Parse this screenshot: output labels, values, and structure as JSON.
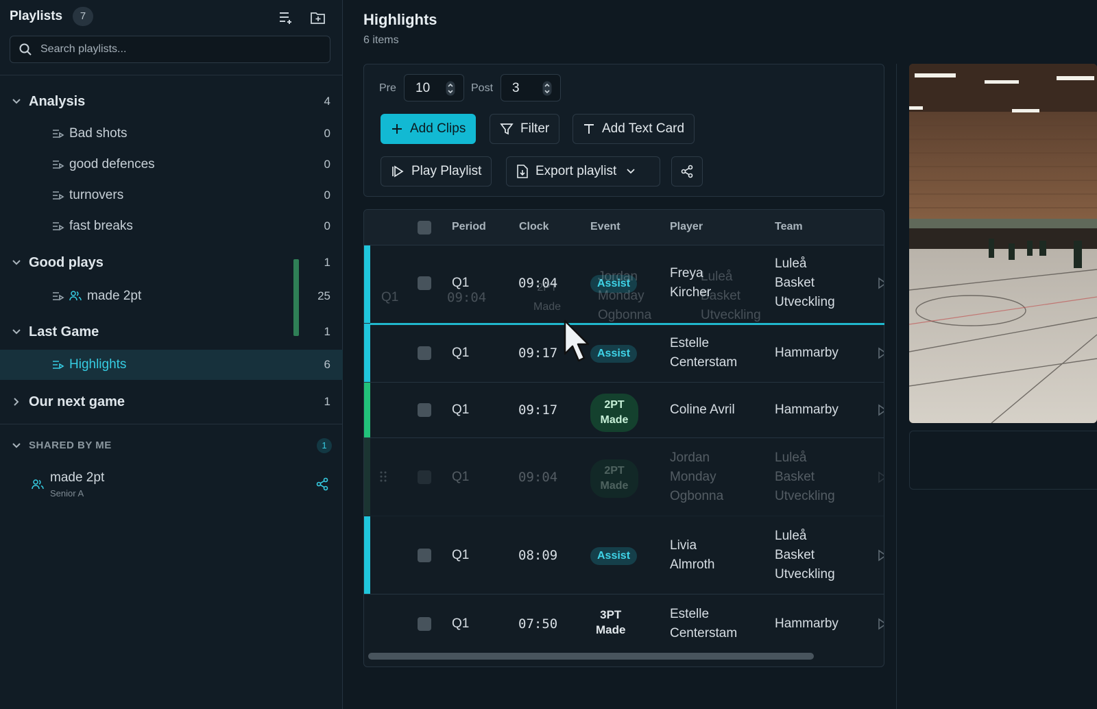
{
  "sidebar": {
    "title": "Playlists",
    "count": "7",
    "search_placeholder": "Search playlists...",
    "groups": [
      {
        "label": "Analysis",
        "count": "4"
      },
      {
        "label": "Good plays",
        "count": "1"
      },
      {
        "label": "Last Game",
        "count": "1"
      },
      {
        "label": "Our next game",
        "count": "1"
      }
    ],
    "items": [
      {
        "label": "Bad shots",
        "count": "0"
      },
      {
        "label": "good defences",
        "count": "0"
      },
      {
        "label": "turnovers",
        "count": "0"
      },
      {
        "label": "fast breaks",
        "count": "0"
      },
      {
        "label": "made 2pt",
        "count": "25"
      },
      {
        "label": "Highlights",
        "count": "6"
      }
    ],
    "shared": {
      "header": "SHARED BY ME",
      "count": "1",
      "item_label": "made 2pt",
      "item_sub": "Senior A"
    }
  },
  "main": {
    "title": "Highlights",
    "subtitle": "6 items",
    "pre_label": "Pre",
    "pre_value": "10",
    "post_label": "Post",
    "post_value": "3",
    "buttons": {
      "add_clips": "Add Clips",
      "filter": "Filter",
      "add_text_card": "Add Text Card",
      "play_playlist": "Play Playlist",
      "export_playlist": "Export playlist"
    },
    "table": {
      "headers": [
        "Period",
        "Clock",
        "Event",
        "Player",
        "Team"
      ],
      "rows": [
        {
          "period": "Q1",
          "clock": "09:04",
          "event": "Assist",
          "player1": "Freya",
          "player2": "Kircher",
          "team1": "Luleå",
          "team2": "Basket",
          "team3": "Utveckling"
        },
        {
          "period": "Q1",
          "clock": "09:17",
          "event": "Assist",
          "player1": "Estelle",
          "player2": "Centerstam",
          "team1": "Hammarby"
        },
        {
          "period": "Q1",
          "clock": "09:17",
          "event1": "2PT",
          "event2": "Made",
          "player1": "Coline Avril",
          "team1": "Hammarby"
        },
        {
          "period": "Q1",
          "clock": "09:04",
          "event1": "2PT",
          "event2": "Made",
          "player1": "Jordan",
          "player2": "Monday",
          "player3": "Ogbonna",
          "team1": "Luleå",
          "team2": "Basket",
          "team3": "Utveckling"
        },
        {
          "period": "Q1",
          "clock": "08:09",
          "event": "Assist",
          "player1": "Livia",
          "player2": "Almroth",
          "team1": "Luleå",
          "team2": "Basket",
          "team3": "Utveckling"
        },
        {
          "period": "Q1",
          "clock": "07:50",
          "event1": "3PT",
          "event2": "Made",
          "player1": "Estelle",
          "player2": "Centerstam",
          "team1": "Hammarby"
        }
      ],
      "drag_ghost": {
        "period": "Q1",
        "clock": "09:04",
        "event1": "2PT",
        "event2": "Made",
        "player1": "Jordan",
        "player2": "Monday",
        "player3": "Ogbonna",
        "team1": "Luleå",
        "team2": "Basket",
        "team3": "Utveckling"
      }
    }
  },
  "colors": {
    "accent": "#12b9d3",
    "assist_stripe": "#20c6dc",
    "made_stripe": "#22c27a",
    "ghost_stripe": "#2f6a50"
  }
}
